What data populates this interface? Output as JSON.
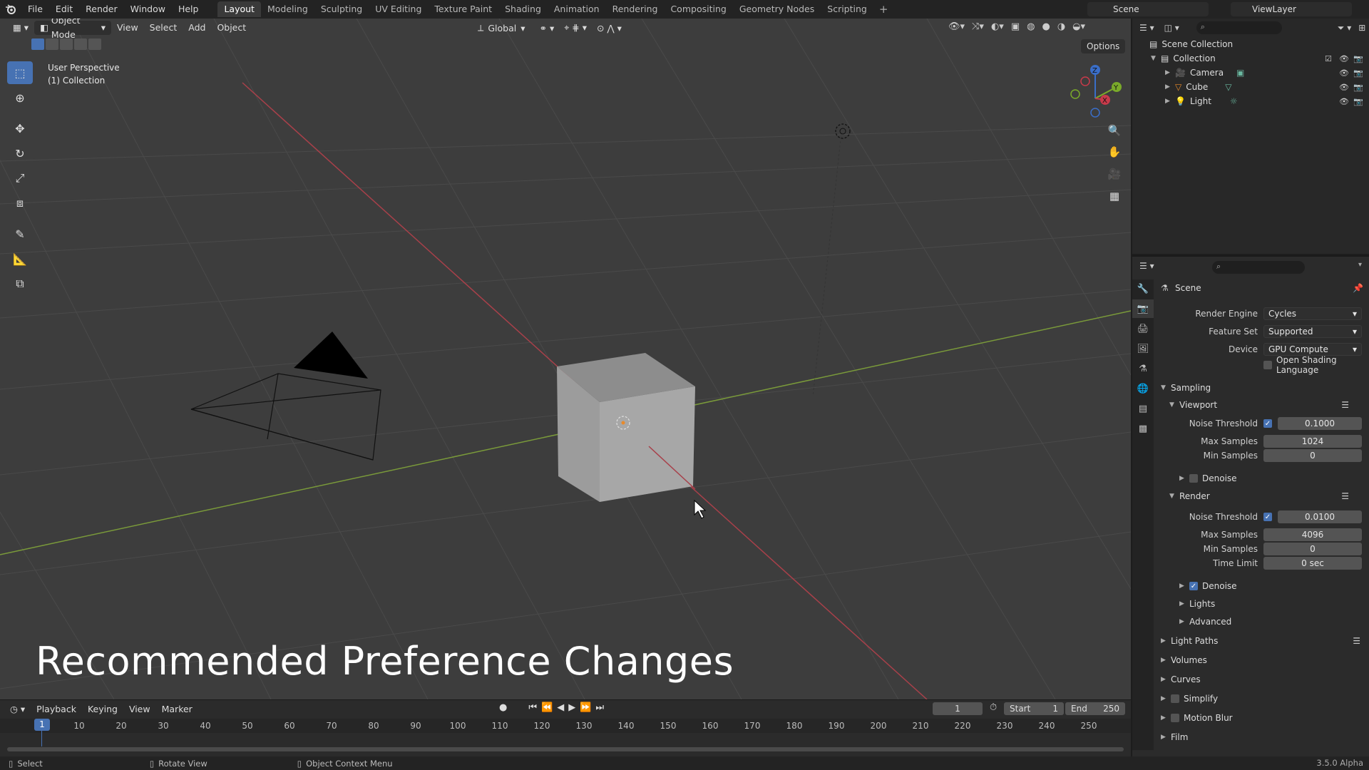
{
  "menubar": {
    "items": [
      "File",
      "Edit",
      "Render",
      "Window",
      "Help"
    ],
    "workspaces": [
      "Layout",
      "Modeling",
      "Sculpting",
      "UV Editing",
      "Texture Paint",
      "Shading",
      "Animation",
      "Rendering",
      "Compositing",
      "Geometry Nodes",
      "Scripting"
    ],
    "active_workspace": "Layout",
    "add_tab": "+",
    "scene": "Scene",
    "view_layer": "ViewLayer"
  },
  "viewport": {
    "mode": "Object Mode",
    "menus": [
      "View",
      "Select",
      "Add",
      "Object"
    ],
    "transform_orientation": "Global",
    "options": "Options",
    "perspective_label": "User Perspective",
    "collection_label": "(1) Collection",
    "caption": "Recommended Preference Changes",
    "gizmo_axes": [
      "Z",
      "Y",
      "X"
    ]
  },
  "timeline": {
    "menus": [
      "Playback",
      "Keying",
      "View",
      "Marker"
    ],
    "current_frame": "1",
    "start_label": "Start",
    "start": "1",
    "end_label": "End",
    "end": "250",
    "ticks": [
      "10",
      "20",
      "30",
      "40",
      "50",
      "60",
      "70",
      "80",
      "90",
      "100",
      "110",
      "120",
      "130",
      "140",
      "150",
      "160",
      "170",
      "180",
      "190",
      "200",
      "210",
      "220",
      "230",
      "240",
      "250"
    ],
    "playhead": "1"
  },
  "statusbar": {
    "select": "Select",
    "rotate": "Rotate View",
    "context": "Object Context Menu",
    "version": "3.5.0 Alpha"
  },
  "outliner": {
    "scene_collection": "Scene Collection",
    "collection": "Collection",
    "objects": [
      "Camera",
      "Cube",
      "Light"
    ]
  },
  "properties": {
    "context": "Scene",
    "render_engine_label": "Render Engine",
    "render_engine": "Cycles",
    "feature_set_label": "Feature Set",
    "feature_set": "Supported",
    "device_label": "Device",
    "device": "GPU Compute",
    "osl_label": "Open Shading Language",
    "sampling": "Sampling",
    "viewport": "Viewport",
    "vp_noise_label": "Noise Threshold",
    "vp_noise": "0.1000",
    "vp_max_label": "Max Samples",
    "vp_max": "1024",
    "vp_min_label": "Min Samples",
    "vp_min": "0",
    "vp_denoise": "Denoise",
    "render": "Render",
    "r_noise_label": "Noise Threshold",
    "r_noise": "0.0100",
    "r_max_label": "Max Samples",
    "r_max": "4096",
    "r_min_label": "Min Samples",
    "r_min": "0",
    "time_limit_label": "Time Limit",
    "time_limit": "0 sec",
    "r_denoise": "Denoise",
    "lights": "Lights",
    "advanced": "Advanced",
    "light_paths": "Light Paths",
    "volumes": "Volumes",
    "curves": "Curves",
    "simplify": "Simplify",
    "motion_blur": "Motion Blur",
    "film": "Film"
  }
}
